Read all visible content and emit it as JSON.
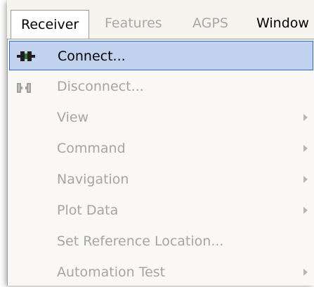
{
  "menubar": {
    "items": [
      {
        "label": "Receiver",
        "state": "active"
      },
      {
        "label": "Features",
        "state": "disabled"
      },
      {
        "label": "AGPS",
        "state": "disabled"
      },
      {
        "label": "Window",
        "state": "enabled"
      }
    ]
  },
  "menu": {
    "items": [
      {
        "label": "Connect...",
        "icon": "plug-connect-icon",
        "enabled": true,
        "highlighted": true,
        "submenu": false
      },
      {
        "label": "Disconnect...",
        "icon": "plug-disconnect-icon",
        "enabled": false,
        "submenu": false
      },
      {
        "label": "View",
        "enabled": false,
        "submenu": true
      },
      {
        "label": "Command",
        "enabled": false,
        "submenu": true
      },
      {
        "label": "Navigation",
        "enabled": false,
        "submenu": true
      },
      {
        "label": "Plot Data",
        "enabled": false,
        "submenu": true
      },
      {
        "label": "Set Reference Location...",
        "enabled": false,
        "submenu": false
      },
      {
        "label": "Automation Test",
        "enabled": false,
        "submenu": true
      }
    ]
  },
  "colors": {
    "highlight_fill": "#c1d2ee",
    "highlight_border": "#3169c6",
    "disabled_text": "#a5a5a5"
  }
}
